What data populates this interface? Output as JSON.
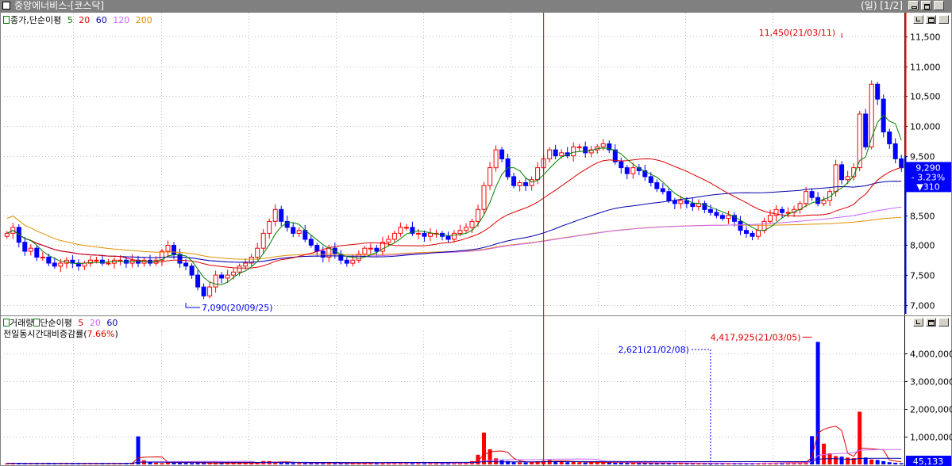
{
  "window": {
    "title": "중앙에너비스-[코스닥]",
    "status": "(일) [1/2]"
  },
  "price_legend": {
    "label": "종가,단순이평",
    "ma": [
      "5",
      "20",
      "60",
      "120",
      "200"
    ]
  },
  "volume_legend": {
    "label": "거래량",
    "label2": "단순이평",
    "ma": [
      "5",
      "20",
      "60"
    ]
  },
  "volume_sub": {
    "label": "전일동시간대비증감률",
    "value": "7.66%"
  },
  "colors": {
    "up": "#ff0000",
    "down": "#0000ff",
    "ma5": "#008000",
    "ma20": "#dd0000",
    "ma60": "#0000aa",
    "ma120": "#cc66ff",
    "ma200": "#e09000",
    "grid": "#bbbbbb"
  },
  "icons": [
    "checkbox-icon",
    "minimize-icon",
    "restore-icon",
    "maximize-icon",
    "close-icon"
  ],
  "chart_data": [
    {
      "type": "candlestick",
      "title": "",
      "ylim": [
        6850,
        11900
      ],
      "yticks": [
        "11,500",
        "11,000",
        "10,500",
        "10,000",
        "9,500",
        "9,000",
        "8,500",
        "8,000",
        "7,500",
        "7,000"
      ],
      "ytick_values": [
        11500,
        11000,
        10500,
        10000,
        9500,
        9000,
        8500,
        8000,
        7500,
        7000
      ],
      "annotations": {
        "high": {
          "label": "11,450(21/03/11)",
          "value": 11450,
          "index": 140
        },
        "low": {
          "label": "7,090(20/09/25)",
          "value": 7090,
          "index": 30
        },
        "current": {
          "price": "9,290",
          "change": "- 3.23%",
          "diff": "▼310",
          "value": 9290
        },
        "marker_index": 90
      },
      "close": [
        8200,
        8300,
        8050,
        7900,
        7950,
        7800,
        7800,
        7700,
        7650,
        7700,
        7750,
        7700,
        7650,
        7700,
        7750,
        7750,
        7700,
        7700,
        7750,
        7750,
        7700,
        7750,
        7700,
        7750,
        7700,
        7750,
        7900,
        8000,
        7850,
        7700,
        7650,
        7500,
        7300,
        7150,
        7300,
        7500,
        7450,
        7500,
        7550,
        7650,
        7700,
        7800,
        7950,
        8200,
        8400,
        8600,
        8400,
        8300,
        8200,
        8250,
        8100,
        8000,
        7900,
        7800,
        7950,
        7850,
        7750,
        7700,
        7750,
        7850,
        7950,
        7950,
        7900,
        8050,
        8100,
        8200,
        8300,
        8300,
        8200,
        8200,
        8150,
        8200,
        8200,
        8150,
        8100,
        8200,
        8250,
        8300,
        8400,
        8600,
        9000,
        9300,
        9600,
        9450,
        9150,
        9000,
        9050,
        9000,
        9100,
        9300,
        9450,
        9600,
        9500,
        9550,
        9500,
        9650,
        9650,
        9550,
        9600,
        9650,
        9700,
        9600,
        9400,
        9300,
        9200,
        9300,
        9250,
        9150,
        9050,
        8950,
        8900,
        8750,
        8700,
        8750,
        8700,
        8650,
        8700,
        8600,
        8550,
        8500,
        8450,
        8500,
        8400,
        8250,
        8200,
        8150,
        8250,
        8400,
        8500,
        8600,
        8550,
        8550,
        8600,
        8700,
        8900,
        8800,
        8700,
        8750,
        8900,
        9350,
        9100,
        9150,
        9300,
        10200,
        9650,
        10700,
        10450,
        9900,
        9700,
        9450,
        9300
      ]
    },
    {
      "type": "bar",
      "title": "",
      "ylim": [
        0,
        4800000
      ],
      "yticks": [
        "4,000,000",
        "3,000,000",
        "2,000,000",
        "1,000,000"
      ],
      "ytick_values": [
        4000000,
        3000000,
        2000000,
        1000000
      ],
      "annotations": {
        "peak": {
          "label": "4,417,925(21/03/05)",
          "value": 4417925,
          "index": 135
        },
        "ref": {
          "label": "2,621(21/02/08)",
          "index": 118
        },
        "current": {
          "label": "45,133",
          "value": 45133
        }
      },
      "volume": [
        40000,
        38000,
        40000,
        35000,
        38000,
        36000,
        40000,
        42000,
        36000,
        38000,
        40000,
        36000,
        35000,
        38000,
        36000,
        35000,
        36000,
        38000,
        40000,
        42000,
        38000,
        60000,
        1010000,
        150000,
        70000,
        60000,
        50000,
        70000,
        80000,
        90000,
        55000,
        50000,
        60000,
        45000,
        40000,
        50000,
        60000,
        55000,
        60000,
        55000,
        45000,
        50000,
        60000,
        120000,
        120000,
        70000,
        80000,
        70000,
        50000,
        45000,
        45000,
        48000,
        60000,
        40000,
        50000,
        45000,
        42000,
        38000,
        40000,
        42000,
        70000,
        40000,
        45000,
        50000,
        60000,
        55000,
        80000,
        80000,
        45000,
        45000,
        40000,
        55000,
        50000,
        45000,
        45000,
        55000,
        60000,
        70000,
        120000,
        350000,
        1150000,
        550000,
        220000,
        150000,
        120000,
        80000,
        70000,
        70000,
        90000,
        110000,
        130000,
        160000,
        110000,
        120000,
        80000,
        90000,
        75000,
        65000,
        70000,
        80000,
        85000,
        75000,
        65000,
        60000,
        55000,
        60000,
        50000,
        55000,
        50000,
        50000,
        45000,
        45000,
        40000,
        42000,
        40000,
        38000,
        42000,
        40000,
        45000,
        40000,
        40000,
        38000,
        40000,
        45000,
        38000,
        40000,
        42000,
        60000,
        55000,
        60000,
        70000,
        60000,
        70000,
        60000,
        80000,
        1020000,
        4417925,
        750000,
        400000,
        300000,
        280000,
        250000,
        230000,
        1900000,
        250000,
        180000,
        160000,
        120000,
        80000,
        60000,
        45133
      ]
    }
  ]
}
